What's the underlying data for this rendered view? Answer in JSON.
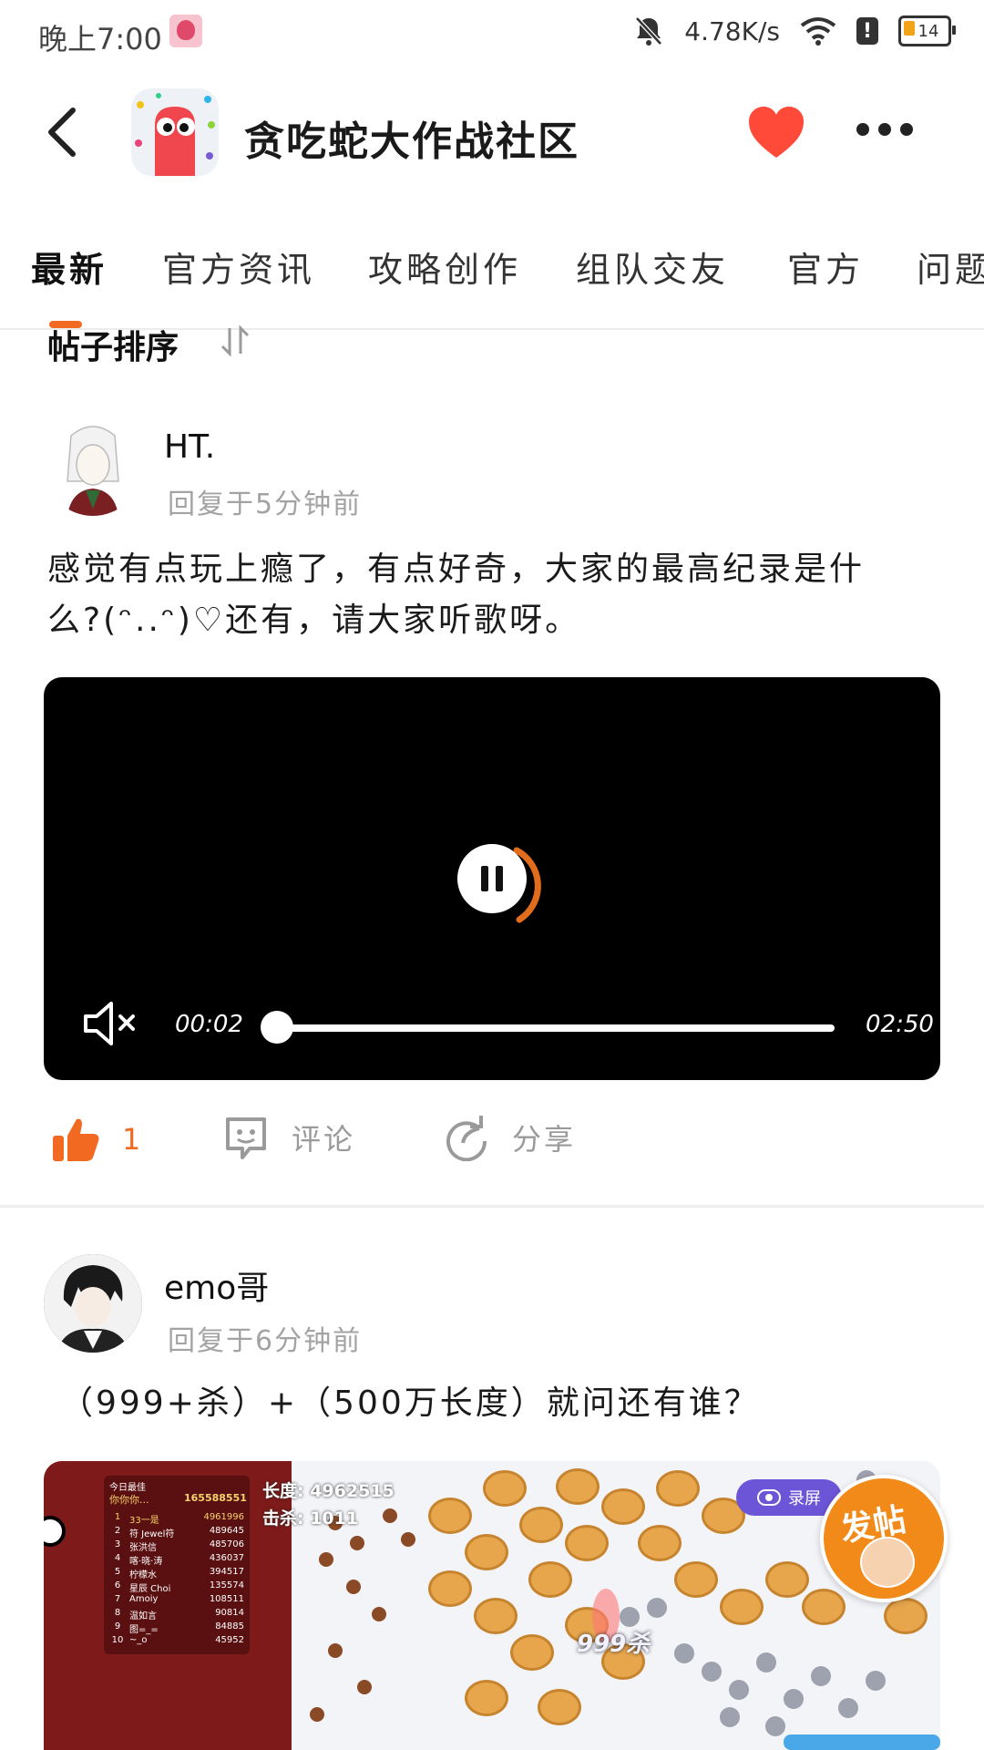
{
  "status_bar": {
    "time": "晚上7:00",
    "net_speed": "4.78K/s",
    "battery": "14"
  },
  "header": {
    "title": "贪吃蛇大作战社区",
    "icons": [
      "back-arrow-icon",
      "app-icon",
      "heart-icon",
      "more-icon"
    ],
    "accent_color": "#f26a21",
    "heart_color": "#ff4a3a"
  },
  "tabs": [
    {
      "label": "最新",
      "active": true
    },
    {
      "label": "官方资讯",
      "active": false
    },
    {
      "label": "攻略创作",
      "active": false
    },
    {
      "label": "组队交友",
      "active": false
    },
    {
      "label": "官方",
      "active": false
    },
    {
      "label": "问题",
      "active": false
    }
  ],
  "sort": {
    "label": "帖子排序",
    "icon": "sort-icon"
  },
  "posts": [
    {
      "username": "HT.",
      "time": "回复于5分钟前",
      "text_line1": "感觉有点玩上瘾了，有点好奇，大家的最高纪录是什",
      "text_line2": "么?(ᵔ..ᵔ)♡还有，请大家听歌呀。",
      "video": {
        "current": "00:02",
        "duration": "02:50",
        "progress": 0.012,
        "muted": true
      },
      "actions": {
        "like_count": "1",
        "comment_label": "评论",
        "share_label": "分享"
      }
    },
    {
      "username": "emo哥",
      "time": "回复于6分钟前",
      "text": "（999+杀）+（500万长度）就问还有谁？",
      "game": {
        "board_title": "今日最佳",
        "best_name": "你你你...",
        "best_score": "165588551",
        "length_label": "长度: 4962515",
        "kills_label": "击杀: 1011",
        "record_label": "录屏",
        "kills_tag": "999杀",
        "leaderboard": [
          {
            "rank": "1",
            "name": "33一是",
            "score": "4961996"
          },
          {
            "rank": "2",
            "name": "符 Jewel符",
            "score": "489645"
          },
          {
            "rank": "3",
            "name": "张洪信",
            "score": "485706"
          },
          {
            "rank": "4",
            "name": "喀·晓·涛",
            "score": "436037"
          },
          {
            "rank": "5",
            "name": "柠檬水",
            "score": "394517"
          },
          {
            "rank": "6",
            "name": "星辰 Choi",
            "score": "135574"
          },
          {
            "rank": "7",
            "name": "Amoiy",
            "score": "108511"
          },
          {
            "rank": "8",
            "name": "温如言",
            "score": "90814"
          },
          {
            "rank": "9",
            "name": "图=_=",
            "score": "84885"
          },
          {
            "rank": "10",
            "name": "~_o",
            "score": "45952"
          }
        ]
      }
    }
  ],
  "fab": {
    "label": "发帖"
  }
}
